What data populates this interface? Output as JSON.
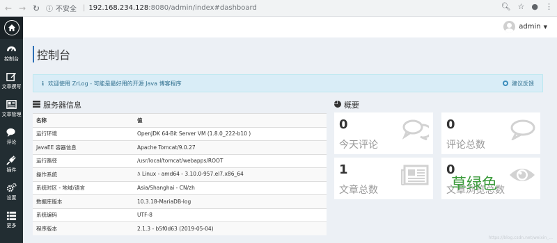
{
  "browser": {
    "insecure_label": "不安全",
    "url_host": "192.168.234.128",
    "url_path": ":8080/admin/index#dashboard"
  },
  "sidebar": {
    "items": [
      {
        "label": "控制台",
        "icon": "dashboard-icon"
      },
      {
        "label": "文章撰写",
        "icon": "edit-icon"
      },
      {
        "label": "文章管理",
        "icon": "newspaper-icon"
      },
      {
        "label": "评论",
        "icon": "comments-icon"
      },
      {
        "label": "插件",
        "icon": "plug-icon"
      },
      {
        "label": "设置",
        "icon": "cogs-icon"
      },
      {
        "label": "更多",
        "icon": "list-icon"
      }
    ]
  },
  "header": {
    "username": "admin"
  },
  "page": {
    "title": "控制台"
  },
  "callout": {
    "text": "欢迎使用 ZrLog - 可能是最好用的开源 Java 博客程序",
    "feedback": "建议反馈"
  },
  "server": {
    "title": "服务器信息",
    "headers": [
      "名称",
      "值"
    ],
    "rows": [
      [
        "运行环境",
        "OpenJDK 64-Bit Server VM (1.8.0_222-b10 )"
      ],
      [
        "JavaEE 容器信息",
        "Apache Tomcat/9.0.27"
      ],
      [
        "运行路径",
        "/usr/local/tomcat/webapps/ROOT"
      ],
      [
        "操作系统",
        "Linux - amd64 - 3.10.0-957.el7.x86_64"
      ],
      [
        "系统时区 - 地域/语言",
        "Asia/Shanghai - CN/zh"
      ],
      [
        "数据库版本",
        "10.3.18-MariaDB-log"
      ],
      [
        "系统编码",
        "UTF-8"
      ],
      [
        "程序版本",
        "2.1.3 - b5f0d63 (2019-05-04)"
      ]
    ]
  },
  "overview": {
    "title": "概要",
    "stats": [
      {
        "value": "0",
        "label": "今天评论",
        "icon": "comments-icon"
      },
      {
        "value": "0",
        "label": "评论总数",
        "icon": "comment-icon"
      },
      {
        "value": "1",
        "label": "文章总数",
        "icon": "newspaper-icon"
      },
      {
        "value": "0",
        "label": "文章浏览总数",
        "icon": "eye-icon"
      }
    ]
  },
  "note": {
    "text": "草绿色",
    "color": "#3c9b3c"
  },
  "watermark": "https://blog.csdn.net/weixin_..."
}
